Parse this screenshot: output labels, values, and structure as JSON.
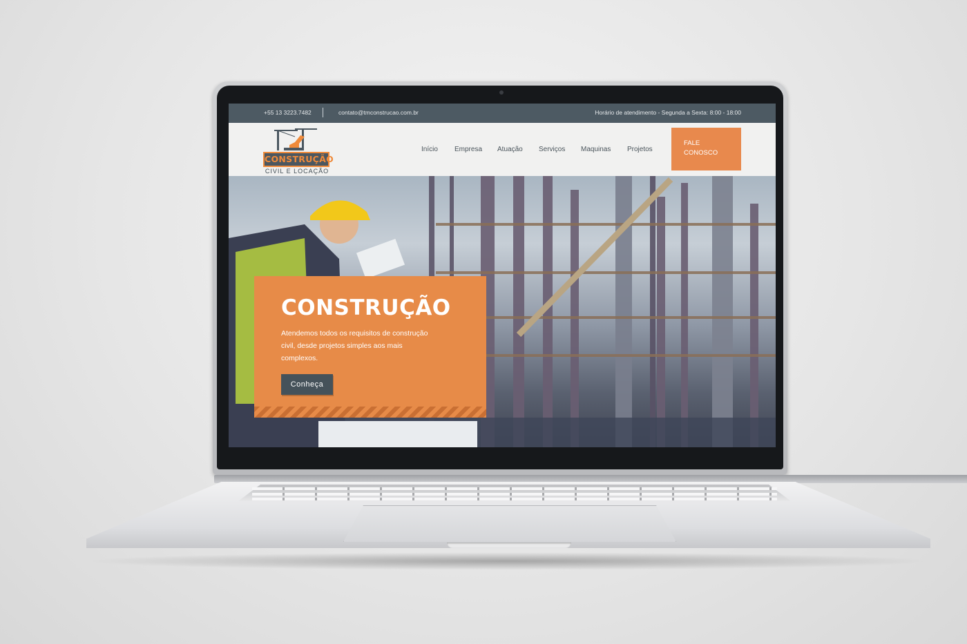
{
  "topbar": {
    "phone": "+55 13 3223.7482",
    "email": "contato@tmconstrucao.com.br",
    "hours": "Horário de atendimento - Segunda a Sexta: 8:00 - 18:00"
  },
  "logo": {
    "wordmark": "CONSTRUÇÃO",
    "subtitle": "CIVIL E LOCAÇÃO"
  },
  "nav": {
    "items": [
      "Início",
      "Empresa",
      "Atuação",
      "Serviços",
      "Maquinas",
      "Projetos"
    ],
    "cta_line1": "FALE",
    "cta_line2": "CONOSCO"
  },
  "hero": {
    "title": "CONSTRUÇÃO",
    "text": "Atendemos todos os requisitos de construção civil, desde projetos simples aos mais complexos.",
    "button": "Conheça"
  },
  "colors": {
    "accent": "#e78b48",
    "dark": "#4d5a63"
  }
}
